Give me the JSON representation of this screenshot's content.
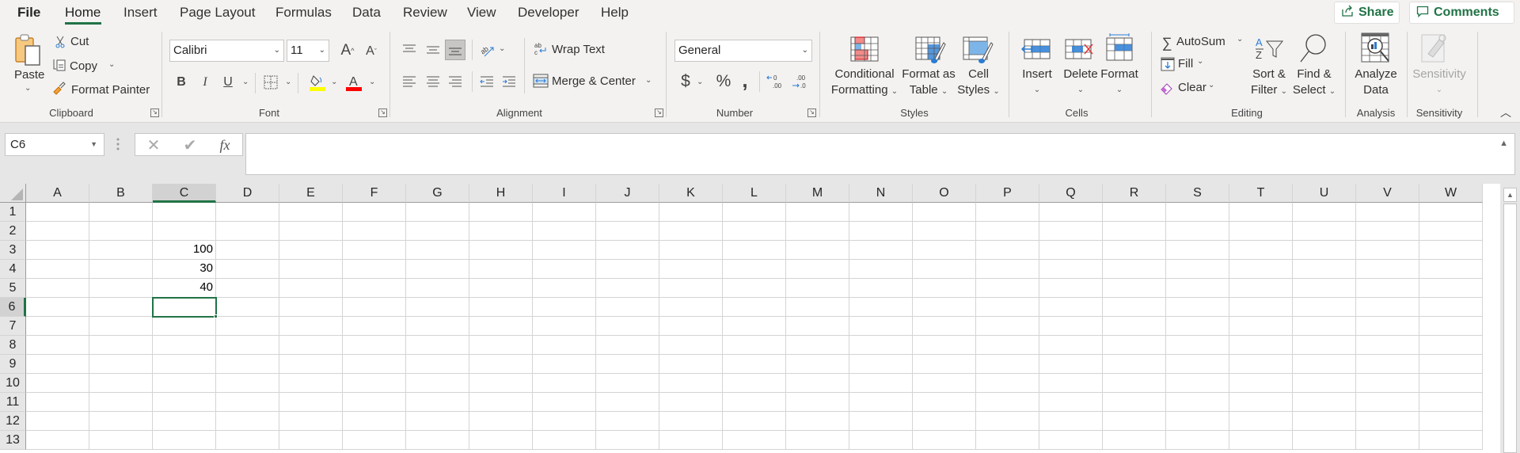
{
  "tabs": [
    {
      "label": "File",
      "active": false
    },
    {
      "label": "Home",
      "active": true
    },
    {
      "label": "Insert",
      "active": false
    },
    {
      "label": "Page Layout",
      "active": false
    },
    {
      "label": "Formulas",
      "active": false
    },
    {
      "label": "Data",
      "active": false
    },
    {
      "label": "Review",
      "active": false
    },
    {
      "label": "View",
      "active": false
    },
    {
      "label": "Developer",
      "active": false
    },
    {
      "label": "Help",
      "active": false
    }
  ],
  "header_buttons": {
    "share": "Share",
    "comments": "Comments"
  },
  "ribbon": {
    "clipboard": {
      "label": "Clipboard",
      "paste": "Paste",
      "cut": "Cut",
      "copy": "Copy",
      "format_painter": "Format Painter"
    },
    "font": {
      "label": "Font",
      "font_name": "Calibri",
      "font_size": "11",
      "bold": "B",
      "italic": "I",
      "underline": "U",
      "highlight_color": "#ffff00",
      "font_color": "#ff0000"
    },
    "alignment": {
      "label": "Alignment",
      "wrap_text": "Wrap Text",
      "merge_center": "Merge & Center"
    },
    "number": {
      "label": "Number",
      "format": "General",
      "currency": "$",
      "percent": "%",
      "comma": ","
    },
    "styles": {
      "label": "Styles",
      "conditional_formatting": [
        "Conditional",
        "Formatting"
      ],
      "format_as_table": [
        "Format as",
        "Table"
      ],
      "cell_styles": [
        "Cell",
        "Styles"
      ]
    },
    "cells": {
      "label": "Cells",
      "insert": "Insert",
      "delete": "Delete",
      "format": "Format"
    },
    "editing": {
      "label": "Editing",
      "autosum": "AutoSum",
      "fill": "Fill",
      "clear": "Clear",
      "sort_filter": [
        "Sort &",
        "Filter"
      ],
      "find_select": [
        "Find &",
        "Select"
      ]
    },
    "analysis": {
      "label": "Analysis",
      "analyze_data": [
        "Analyze",
        "Data"
      ]
    },
    "sensitivity": {
      "label": "Sensitivity",
      "button": "Sensitivity"
    }
  },
  "formula_bar": {
    "name_box": "C6",
    "formula": "",
    "fx": "fx"
  },
  "sheet": {
    "columns": [
      "A",
      "B",
      "C",
      "D",
      "E",
      "F",
      "G",
      "H",
      "I",
      "J",
      "K",
      "L",
      "M",
      "N",
      "O",
      "P",
      "Q",
      "R",
      "S",
      "T",
      "U",
      "V",
      "W"
    ],
    "rows": [
      "1",
      "2",
      "3",
      "4",
      "5",
      "6",
      "7",
      "8",
      "9",
      "10",
      "11",
      "12",
      "13"
    ],
    "selected_cell": "C6",
    "cells": {
      "C3": "100",
      "C4": "30",
      "C5": "40"
    }
  },
  "accent_color": "#217346"
}
